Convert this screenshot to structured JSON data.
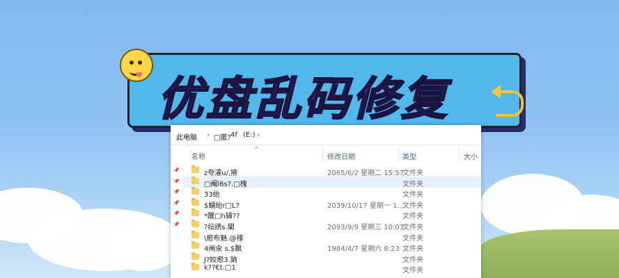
{
  "banner": {
    "title": "优盘乱码修复"
  },
  "explorer": {
    "breadcrumb": [
      "此电脑",
      "□匿?",
      "4f",
      "(E:)"
    ],
    "columns": {
      "name": "名称",
      "date": "修改日期",
      "type": "类型",
      "size": "大小"
    },
    "rows": [
      {
        "name": "z夸灌u/,掖",
        "date": "2065/6/2 星期二 15:57",
        "type": "文件夹",
        "pinned": true,
        "selected": false
      },
      {
        "name": "□阉l6s?.□槐",
        "date": "",
        "type": "文件夹",
        "pinned": true,
        "selected": true
      },
      {
        "name": "33绐",
        "date": "",
        "type": "文件夹",
        "pinned": true,
        "selected": false
      },
      {
        "name": "$蠕绐r□L?",
        "date": "2039/10/17 星期一 1...",
        "type": "文件夹",
        "pinned": true,
        "selected": false
      },
      {
        "name": "*醒□h辅??",
        "date": "",
        "type": "文件夹",
        "pinned": true,
        "selected": false
      },
      {
        "name": "?纭绣s.閵",
        "date": "2093/9/9 星期三 10:03",
        "type": "文件夹",
        "pinned": true,
        "selected": false
      },
      {
        "name": "\\瘛布魅.@禒",
        "date": "",
        "type": "文件夹",
        "pinned": false,
        "selected": false
      },
      {
        "name": "4闸氽 s.$飘",
        "date": "1984/4/7 星期六 8:23",
        "type": "文件夹",
        "pinned": false,
        "selected": false
      },
      {
        "name": "J?姣瘛3.鈉",
        "date": "",
        "type": "文件夹",
        "pinned": false,
        "selected": false
      },
      {
        "name": "k??€t.□1",
        "date": "",
        "type": "文件夹",
        "pinned": false,
        "selected": false
      }
    ]
  }
}
